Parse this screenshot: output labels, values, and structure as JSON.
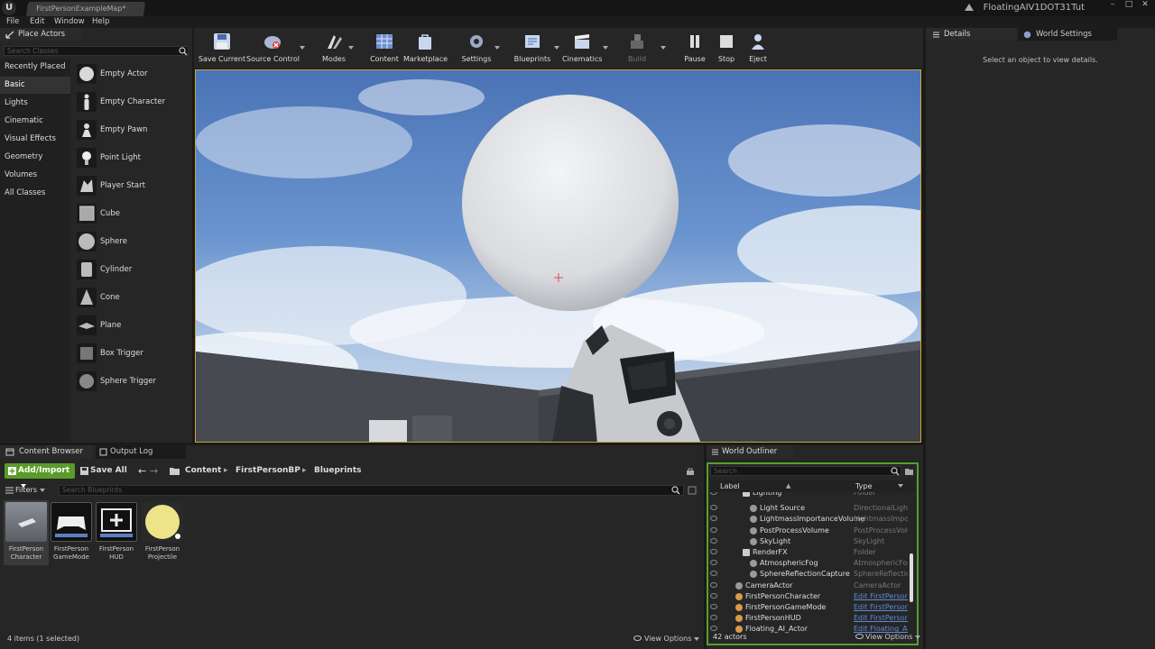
{
  "window": {
    "map_tab": "FirstPersonExampleMap*",
    "project_name": "FloatingAIV1DOT31Tut",
    "controls": [
      "–",
      "□",
      "✕"
    ]
  },
  "menu": [
    "File",
    "Edit",
    "Window",
    "Help"
  ],
  "place_actors": {
    "tab": "Place Actors",
    "search_placeholder": "Search Classes",
    "categories": [
      "Recently Placed",
      "Basic",
      "Lights",
      "Cinematic",
      "Visual Effects",
      "Geometry",
      "Volumes",
      "All Classes"
    ],
    "active_category": "Basic",
    "items": [
      "Empty Actor",
      "Empty Character",
      "Empty Pawn",
      "Point Light",
      "Player Start",
      "Cube",
      "Sphere",
      "Cylinder",
      "Cone",
      "Plane",
      "Box Trigger",
      "Sphere Trigger"
    ]
  },
  "toolbar": {
    "save_current": "Save Current",
    "source_control": "Source Control",
    "modes": "Modes",
    "content": "Content",
    "marketplace": "Marketplace",
    "settings": "Settings",
    "blueprints": "Blueprints",
    "cinematics": "Cinematics",
    "build": "Build",
    "pause": "Pause",
    "stop": "Stop",
    "eject": "Eject"
  },
  "details": {
    "tab": "Details",
    "world_settings_tab": "World Settings",
    "empty_message": "Select an object to view details."
  },
  "content_browser": {
    "tab": "Content Browser",
    "output_log_tab": "Output Log",
    "add_import": "Add/Import",
    "save_all": "Save All",
    "breadcrumb": [
      "Content",
      "FirstPersonBP",
      "Blueprints"
    ],
    "filters": "Filters",
    "search_placeholder": "Search Blueprints",
    "assets": [
      {
        "line1": "FirstPerson",
        "line2": "Character"
      },
      {
        "line1": "FirstPerson",
        "line2": "GameMode"
      },
      {
        "line1": "FirstPerson",
        "line2": "HUD"
      },
      {
        "line1": "FirstPerson",
        "line2": "Projectile"
      }
    ],
    "item_count": "4 items (1 selected)",
    "view_options": "View Options"
  },
  "world_outliner": {
    "tab": "World Outliner",
    "search_placeholder": "Search",
    "col_label": "Label",
    "col_type": "Type",
    "rows": [
      {
        "label": "Lighting",
        "type": "Folder",
        "indent": 2,
        "link": false
      },
      {
        "label": "Light Source",
        "type": "DirectionalLight",
        "indent": 3,
        "link": false
      },
      {
        "label": "LightmassImportanceVolume",
        "type": "LightmassImportance",
        "indent": 3,
        "link": false
      },
      {
        "label": "PostProcessVolume",
        "type": "PostProcessVolume",
        "indent": 3,
        "link": false
      },
      {
        "label": "SkyLight",
        "type": "SkyLight",
        "indent": 3,
        "link": false
      },
      {
        "label": "RenderFX",
        "type": "Folder",
        "indent": 2,
        "link": false
      },
      {
        "label": "AtmosphericFog",
        "type": "AtmosphericFog",
        "indent": 3,
        "link": false
      },
      {
        "label": "SphereReflectionCapture",
        "type": "SphereReflection",
        "indent": 3,
        "link": false
      },
      {
        "label": "CameraActor",
        "type": "CameraActor",
        "indent": 1,
        "link": false
      },
      {
        "label": "FirstPersonCharacter",
        "type": "Edit FirstPerson",
        "indent": 1,
        "link": true
      },
      {
        "label": "FirstPersonGameMode",
        "type": "Edit FirstPerson",
        "indent": 1,
        "link": true
      },
      {
        "label": "FirstPersonHUD",
        "type": "Edit FirstPerson",
        "indent": 1,
        "link": true
      },
      {
        "label": "Floating_AI_Actor",
        "type": "Edit Floating_AI",
        "indent": 1,
        "link": true
      }
    ],
    "actor_count": "42 actors",
    "view_options": "View Options"
  },
  "colors": {
    "accent_green": "#5a9b2a",
    "viewport_border": "#c9a43a",
    "link_blue": "#5f8bd6"
  }
}
